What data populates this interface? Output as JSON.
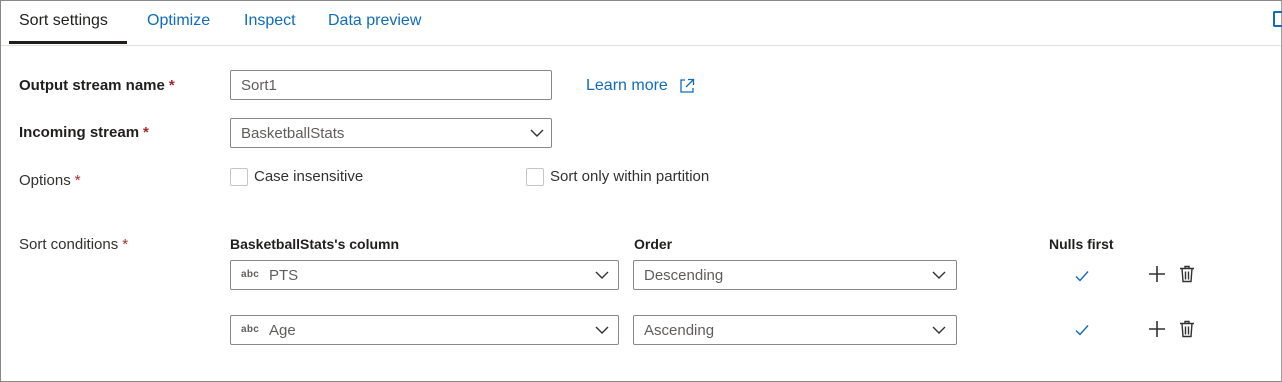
{
  "tabs": [
    {
      "label": "Sort settings"
    },
    {
      "label": "Optimize"
    },
    {
      "label": "Inspect"
    },
    {
      "label": "Data preview"
    }
  ],
  "form": {
    "output_stream_label": "Output stream name",
    "output_stream_value": "Sort1",
    "learn_more": "Learn more",
    "incoming_stream_label": "Incoming stream",
    "incoming_stream_value": "BasketballStats",
    "options_label": "Options",
    "case_insensitive": "Case insensitive",
    "sort_within_partition": "Sort only within partition",
    "sort_conditions_label": "Sort conditions",
    "required_mark": "*"
  },
  "sort_table": {
    "col_header": "BasketballStats's column",
    "order_header": "Order",
    "nulls_header": "Nulls first",
    "type_badge": "abc",
    "rows": [
      {
        "column": "PTS",
        "order": "Descending",
        "nulls_first": true
      },
      {
        "column": "Age",
        "order": "Ascending",
        "nulls_first": true
      }
    ]
  },
  "colors": {
    "accent": "#0f6cbd",
    "required": "#a4262c",
    "border": "#8a8886"
  },
  "icons": [
    "chevron-down-icon",
    "open-external-icon",
    "check-icon",
    "add-icon",
    "delete-icon"
  ]
}
